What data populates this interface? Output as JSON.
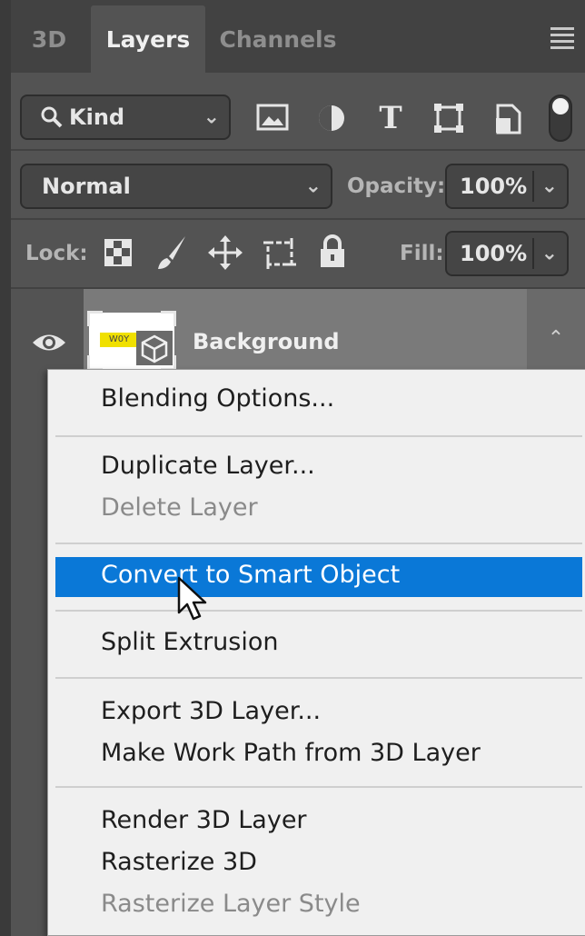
{
  "tabs": [
    {
      "label": "3D",
      "active": false
    },
    {
      "label": "Layers",
      "active": true
    },
    {
      "label": "Channels",
      "active": false
    }
  ],
  "filter": {
    "kind_label": "Kind"
  },
  "blend": {
    "mode": "Normal",
    "opacity_label": "Opacity:",
    "opacity_value": "100%"
  },
  "lock": {
    "label": "Lock:",
    "fill_label": "Fill:",
    "fill_value": "100%"
  },
  "layer": {
    "name": "Background",
    "thumb_text": "W0Y"
  },
  "menu": {
    "items": [
      {
        "label": "Blending Options...",
        "enabled": true
      },
      {
        "label": "Duplicate Layer...",
        "enabled": true
      },
      {
        "label": "Delete Layer",
        "enabled": false
      },
      {
        "label": "Convert to Smart Object",
        "enabled": true,
        "highlighted": true
      },
      {
        "label": "Split Extrusion",
        "enabled": true
      },
      {
        "label": "Export 3D Layer...",
        "enabled": true
      },
      {
        "label": "Make Work Path from 3D Layer",
        "enabled": true
      },
      {
        "label": "Render 3D Layer",
        "enabled": true
      },
      {
        "label": "Rasterize 3D",
        "enabled": true
      },
      {
        "label": "Rasterize Layer Style",
        "enabled": false
      }
    ]
  },
  "colors": {
    "panel": "#535353",
    "header": "#424242",
    "menu_bg": "#f0f0f0",
    "highlight": "#0a78d7",
    "layer_row": "#7a7a7a"
  }
}
